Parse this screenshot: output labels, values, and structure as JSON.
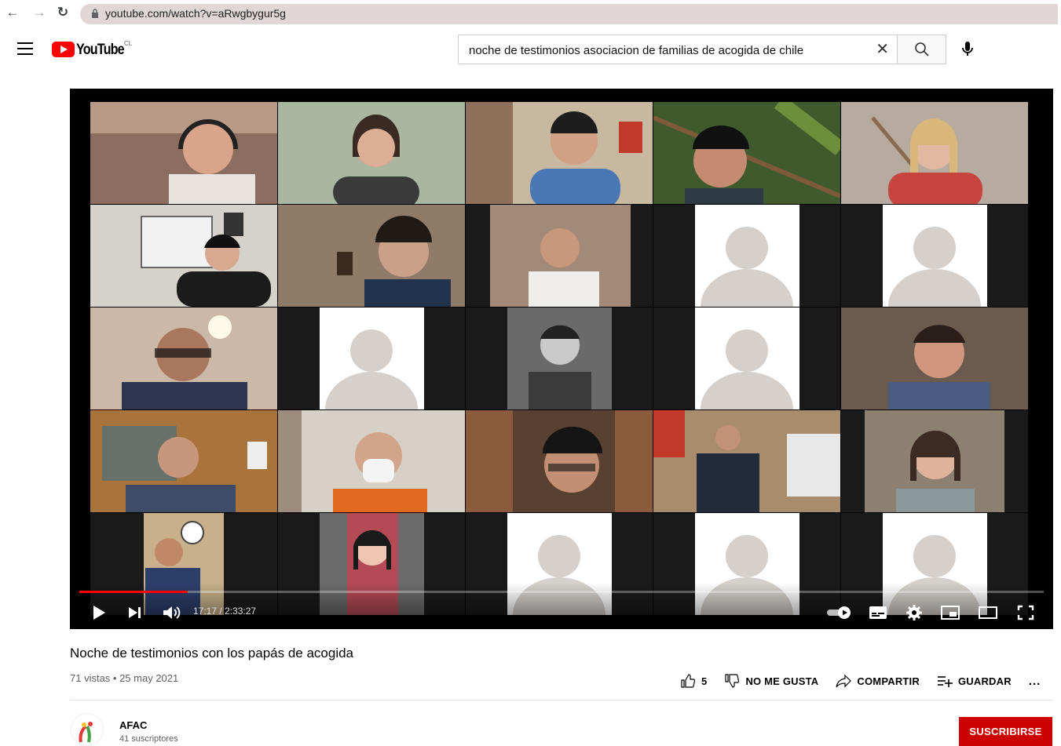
{
  "browser": {
    "url": "youtube.com/watch?v=aRwgbygur5g"
  },
  "masthead": {
    "logo_text": "YouTube",
    "country": "CL",
    "search_value": "noche de testimonios asociacion de familias de acogida de chile"
  },
  "player": {
    "time_display": "17:17 / 2:33:27",
    "progress_fraction": 0.112
  },
  "video": {
    "title": "Noche de testimonios con los papás de acogida",
    "views_date": "71 vistas • 25 may 2021",
    "like_count": "5",
    "dislike_label": "NO ME GUSTA",
    "share_label": "COMPARTIR",
    "save_label": "GUARDAR",
    "more_label": "..."
  },
  "channel": {
    "name": "AFAC",
    "subscribers": "41 suscriptores",
    "subscribe_label": "SUSCRIBIRSE"
  },
  "colors": {
    "accent": "#ff0000",
    "subscribe": "#cc0000"
  }
}
